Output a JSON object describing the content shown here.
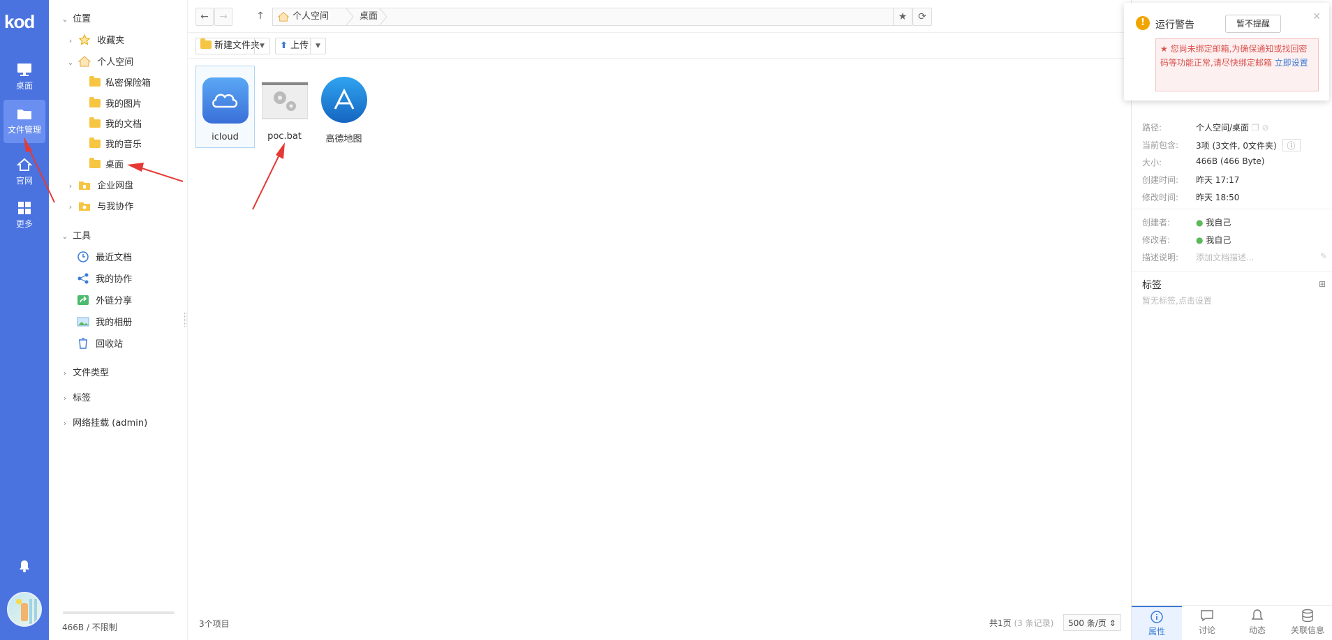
{
  "rail": {
    "logo": "kod",
    "items": [
      {
        "label": "桌面"
      },
      {
        "label": "文件管理"
      },
      {
        "label": "官网"
      },
      {
        "label": "更多"
      }
    ]
  },
  "tree": {
    "location_label": "位置",
    "favorites": "收藏夹",
    "personal_space": "个人空间",
    "children": [
      "私密保险箱",
      "我的图片",
      "我的文档",
      "我的音乐",
      "桌面"
    ],
    "enterprise": "企业网盘",
    "collab": "与我协作",
    "tools_label": "工具",
    "tools": [
      "最近文档",
      "我的协作",
      "外链分享",
      "我的相册",
      "回收站"
    ],
    "file_types": "文件类型",
    "tags": "标签",
    "network_mount": "网络挂载 (admin)",
    "quota": "466B / 不限制",
    "quota_used_fraction": 0.0
  },
  "breadcrumb": [
    "个人空间",
    "桌面"
  ],
  "toolbar": {
    "new_folder": "新建文件夹",
    "upload": "上传"
  },
  "files": [
    {
      "name": "icloud"
    },
    {
      "name": "poc.bat"
    },
    {
      "name": "高德地图"
    }
  ],
  "status": {
    "items": "3个项目",
    "pages": "共1页",
    "records": "(3 条记录)",
    "per_page": "500 条/页"
  },
  "panel": {
    "path_label": "路径:",
    "path": "个人空间/桌面",
    "contains_label": "当前包含:",
    "contains": "3项 (3文件, 0文件夹)",
    "size_label": "大小:",
    "size": "466B (466 Byte)",
    "created_label": "创建时间:",
    "created": "昨天 17:17",
    "modified_label": "修改时间:",
    "modified": "昨天 18:50",
    "creator_label": "创建者:",
    "creator": "我自己",
    "modifier_label": "修改者:",
    "modifier": "我自己",
    "desc_label": "描述说明:",
    "desc_placeholder": "添加文档描述...",
    "tags_title": "标签",
    "tags_empty": "暂无标签,点击设置",
    "tabs": [
      "属性",
      "讨论",
      "动态",
      "关联信息"
    ]
  },
  "warning": {
    "title": "运行警告",
    "button": "暂不提醒",
    "message": "★ 您尚未绑定邮箱,为确保通知或找回密码等功能正常,请尽快绑定邮箱",
    "link": "立即设置"
  },
  "colors": {
    "rail": "#4a73e0",
    "accent": "#3a7bd5",
    "warning": "#f0a500",
    "annotation_arrow": "#e53935"
  }
}
